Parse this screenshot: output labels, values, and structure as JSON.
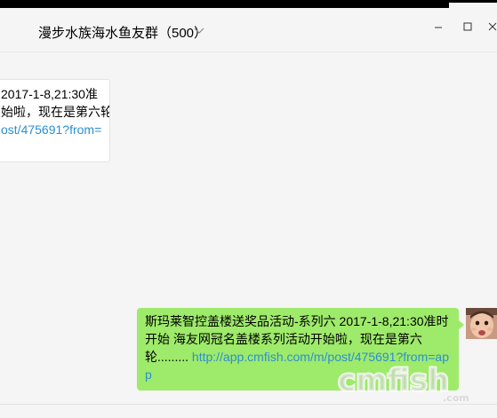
{
  "window": {
    "title": "漫步水族海水鱼友群（500）"
  },
  "messages": [
    {
      "side": "left",
      "lines": [
        "2017-1-8,21:30准",
        "始啦，现在是第六轮"
      ],
      "link": "ost/475691?from="
    },
    {
      "side": "right",
      "text": "斯玛莱智控盖楼送奖品活动-系列六 2017-1-8,21:30准时开始 海友网冠名盖楼系列活动开始啦，现在是第六轮......... ",
      "link": "http://app.cmfish.com/m/post/475691?from=app"
    }
  ],
  "icons": {
    "title_chevron": "chevron-down-icon",
    "minimize": "minimize-icon",
    "maximize": "maximize-icon",
    "close": "close-icon"
  },
  "colors": {
    "own_bubble": "#9eea6a",
    "other_bubble": "#ffffff",
    "link": "#2b8fd1",
    "background": "#f5f5f5"
  },
  "watermark": {
    "brand": "cmfish",
    "suffix": ".com"
  }
}
